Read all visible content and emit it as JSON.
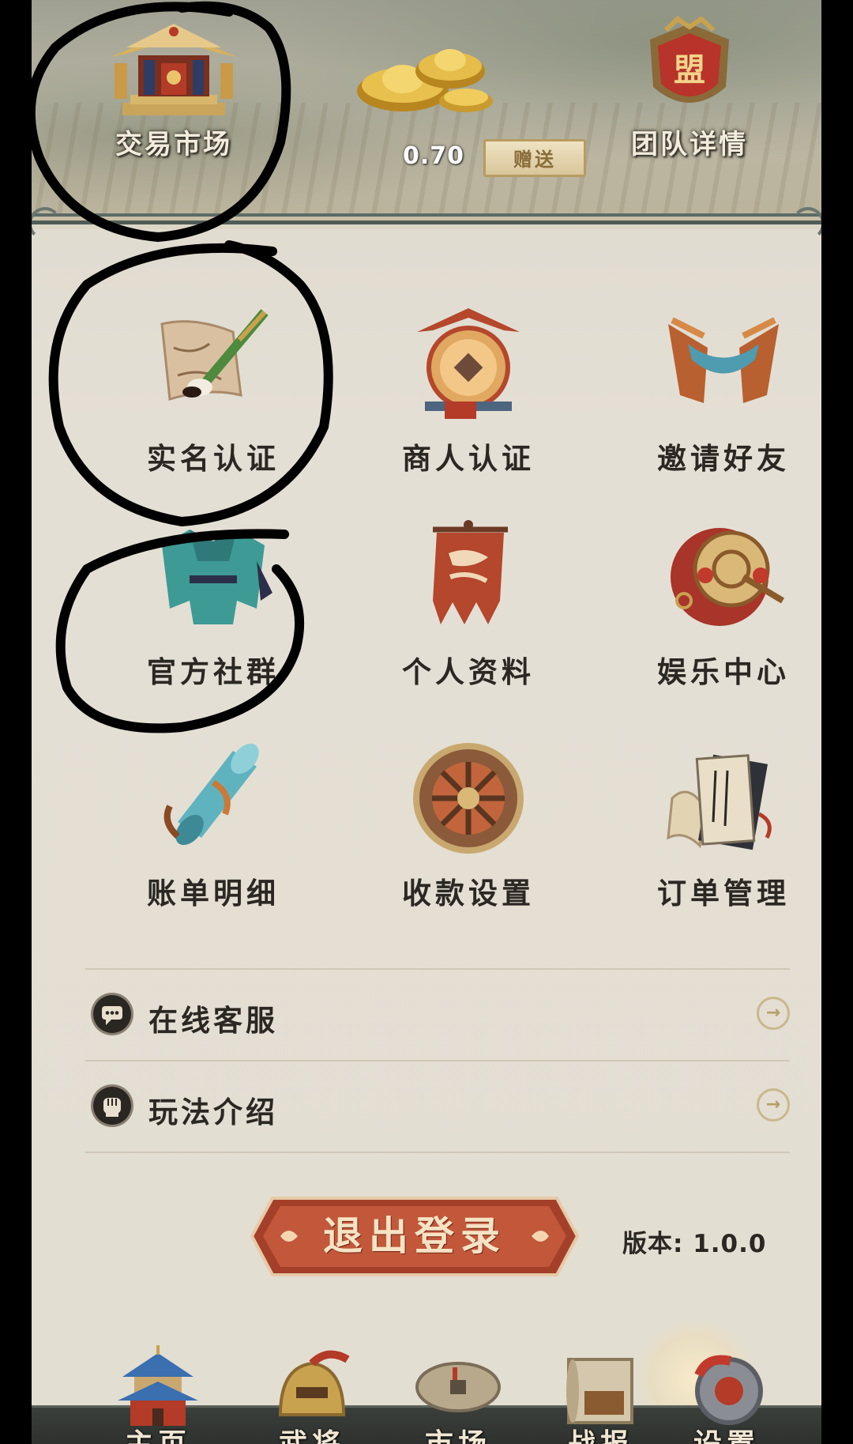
{
  "header": {
    "market_label": "交易市场",
    "balance": "0.70",
    "gift_label": "赠送",
    "team_label": "团队详情",
    "team_emblem_char": "盟"
  },
  "grid": [
    {
      "label": "实名认证",
      "icon": "brush-scroll-icon"
    },
    {
      "label": "商人认证",
      "icon": "merchant-coin-icon"
    },
    {
      "label": "邀请好友",
      "icon": "invite-scroll-icon"
    },
    {
      "label": "官方社群",
      "icon": "robe-icon"
    },
    {
      "label": "个人资料",
      "icon": "banner-icon"
    },
    {
      "label": "娱乐中心",
      "icon": "drum-icon"
    },
    {
      "label": "账单明细",
      "icon": "scroll-roll-icon"
    },
    {
      "label": "收款设置",
      "icon": "wheel-icon"
    },
    {
      "label": "订单管理",
      "icon": "books-icon"
    }
  ],
  "list": [
    {
      "label": "在线客服",
      "icon": "chat-icon"
    },
    {
      "label": "玩法介绍",
      "icon": "fist-icon"
    }
  ],
  "logout_label": "退出登录",
  "version_label": "版本: 1.0.0",
  "bottom_nav": [
    {
      "label": "主页",
      "icon": "pagoda-icon"
    },
    {
      "label": "武将",
      "icon": "helmet-icon"
    },
    {
      "label": "市场",
      "icon": "coin-icon"
    },
    {
      "label": "战报",
      "icon": "report-scroll-icon"
    },
    {
      "label": "设置",
      "icon": "gear-icon"
    }
  ],
  "colors": {
    "accent_red": "#b4472c",
    "gold": "#c9a24f",
    "background": "#e3ded2",
    "text_dark": "#2b2722",
    "annotation_ink": "#000000"
  }
}
